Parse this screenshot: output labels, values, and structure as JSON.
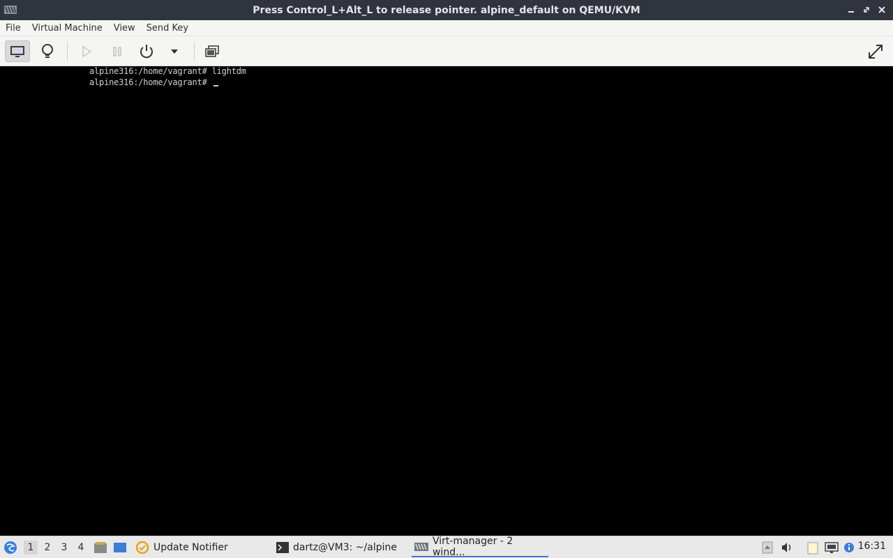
{
  "window": {
    "title": "Press Control_L+Alt_L to release pointer. alpine_default on QEMU/KVM",
    "app_icon": "virt-manager-icon",
    "controls": [
      "minimize-icon",
      "restore-icon",
      "close-icon"
    ]
  },
  "menubar": {
    "items": [
      "File",
      "Virtual Machine",
      "View",
      "Send Key"
    ]
  },
  "toolbar": {
    "buttons": [
      {
        "icon": "monitor-icon",
        "active": true
      },
      {
        "icon": "lightbulb-icon",
        "active": false
      },
      {
        "icon": "play-icon",
        "active": false
      },
      {
        "icon": "pause-icon",
        "active": false
      },
      {
        "icon": "power-icon",
        "active": false
      },
      {
        "icon": "dropdown-arrow-icon",
        "active": false
      },
      {
        "icon": "snapshots-icon",
        "active": false
      },
      {
        "icon": "fullscreen-icon",
        "active": false
      }
    ]
  },
  "terminal": {
    "lines": [
      "alpine316:/home/vagrant# lightdm",
      "alpine316:/home/vagrant# "
    ]
  },
  "taskbar": {
    "workspaces": [
      "1",
      "2",
      "3",
      "4"
    ],
    "active_workspace": "1",
    "tasks": [
      {
        "label": "Update Notifier",
        "icon": "update-notifier-icon"
      },
      {
        "label": "dartz@VM3: ~/alpine",
        "icon": "terminal-icon"
      },
      {
        "label": "Virt-manager - 2 wind...",
        "icon": "virt-manager-icon",
        "active": true
      }
    ],
    "clock": "16:31"
  },
  "colors": {
    "titlebar": "#2f343f",
    "accent": "#3d79c7",
    "terminal_bg": "#000000"
  }
}
